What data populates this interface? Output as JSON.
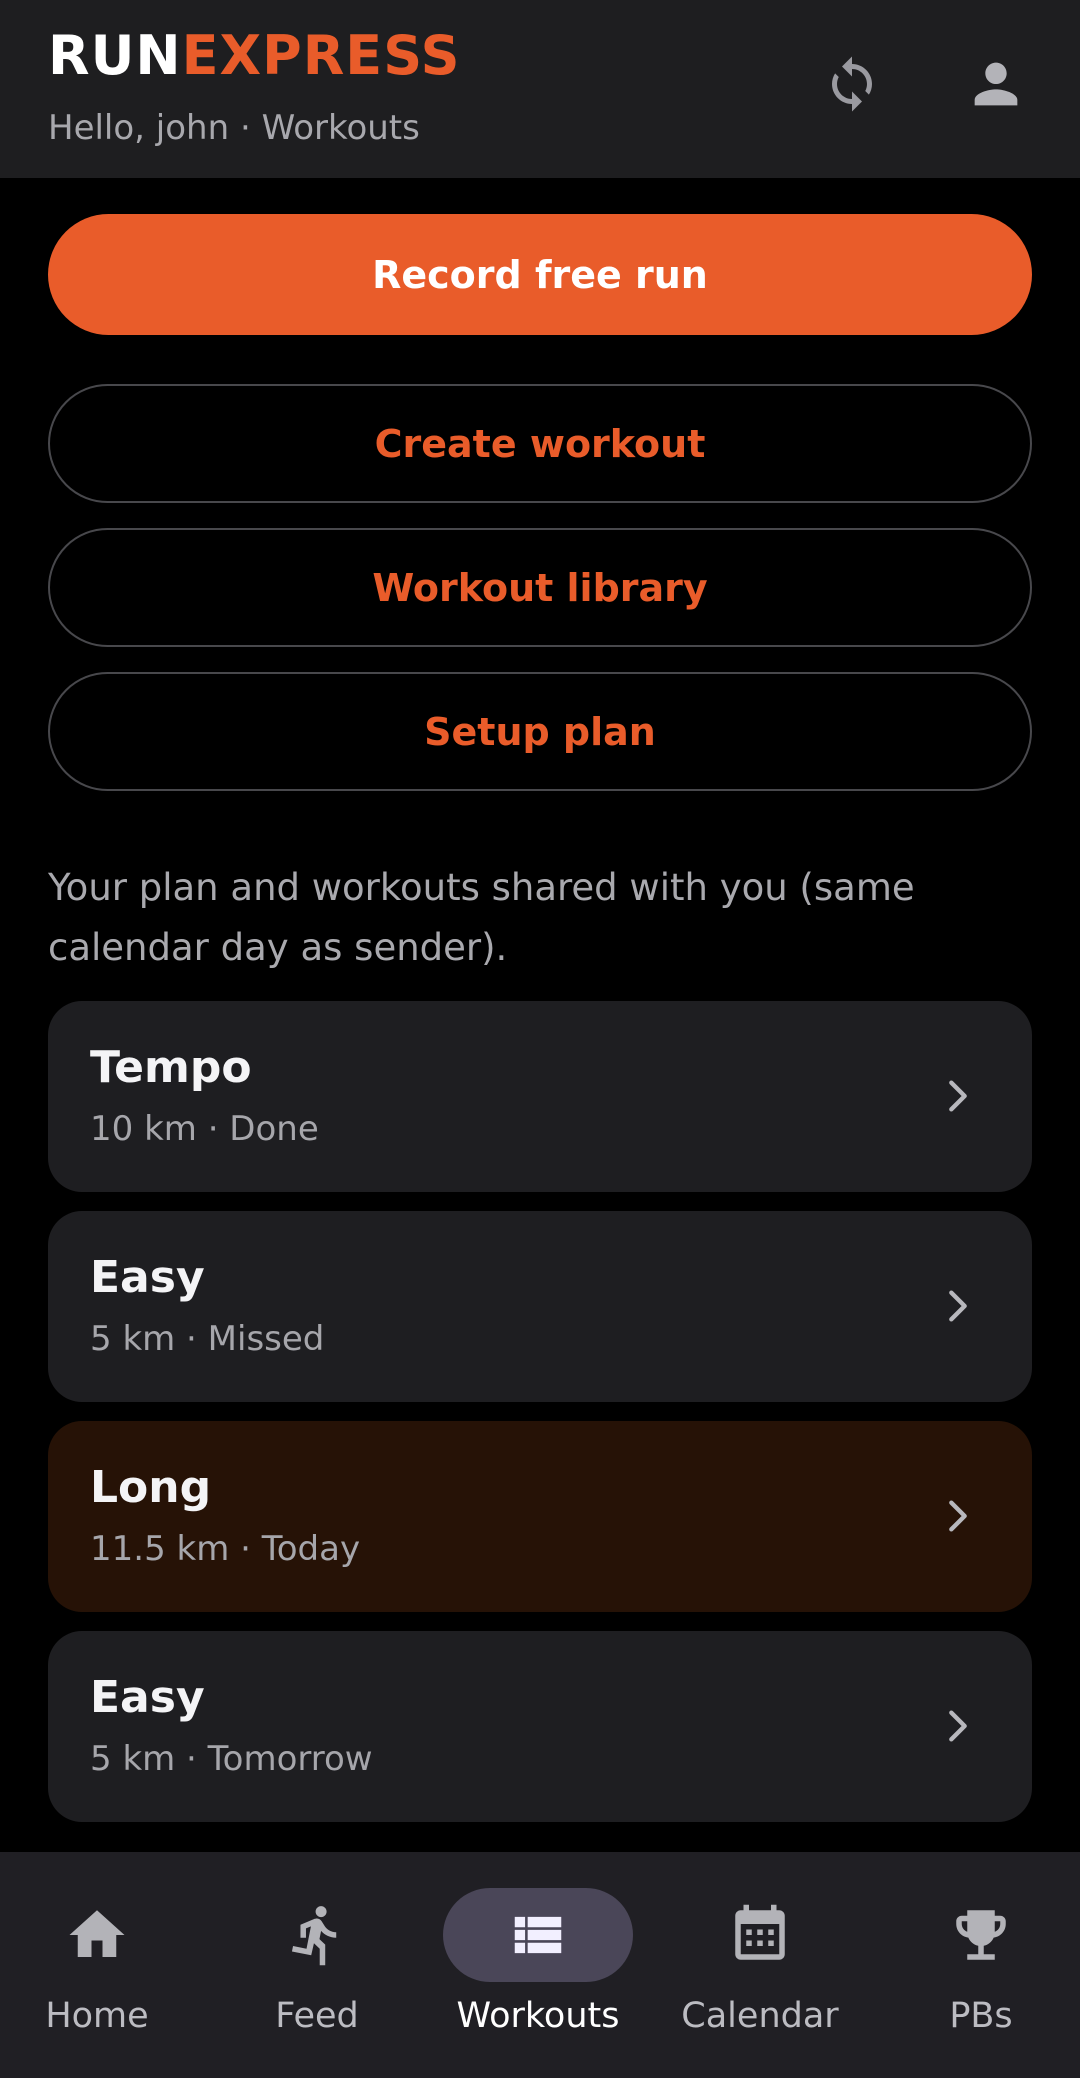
{
  "header": {
    "brand_part1": "RUN",
    "brand_part2": "EXPRESS",
    "subtitle": "Hello, john · Workouts",
    "sync_icon": "sync-icon",
    "account_icon": "account-icon"
  },
  "actions": {
    "record_label": "Record free run",
    "create_label": "Create workout",
    "library_label": "Workout library",
    "setup_label": "Setup plan"
  },
  "info_text": "Your plan and workouts shared with you (same calendar day as sender).",
  "workouts": [
    {
      "title": "Tempo",
      "subtitle": "10 km · Done",
      "highlight": false
    },
    {
      "title": "Easy",
      "subtitle": "5 km · Missed",
      "highlight": false
    },
    {
      "title": "Long",
      "subtitle": "11.5 km · Today",
      "highlight": true
    },
    {
      "title": "Easy",
      "subtitle": "5 km · Tomorrow",
      "highlight": false
    }
  ],
  "nav": {
    "items": [
      {
        "label": "Home",
        "icon": "home-icon",
        "active": false
      },
      {
        "label": "Feed",
        "icon": "running-icon",
        "active": false
      },
      {
        "label": "Workouts",
        "icon": "list-icon",
        "active": true
      },
      {
        "label": "Calendar",
        "icon": "calendar-icon",
        "active": false
      },
      {
        "label": "PBs",
        "icon": "trophy-icon",
        "active": false
      }
    ]
  },
  "colors": {
    "accent": "#e95c2a",
    "background": "#000000",
    "header_bg": "#1e1e20",
    "card_bg": "#1e1e21",
    "card_today_bg": "#261206",
    "nav_bg": "#201f24",
    "nav_active_pill": "#4a4658"
  }
}
